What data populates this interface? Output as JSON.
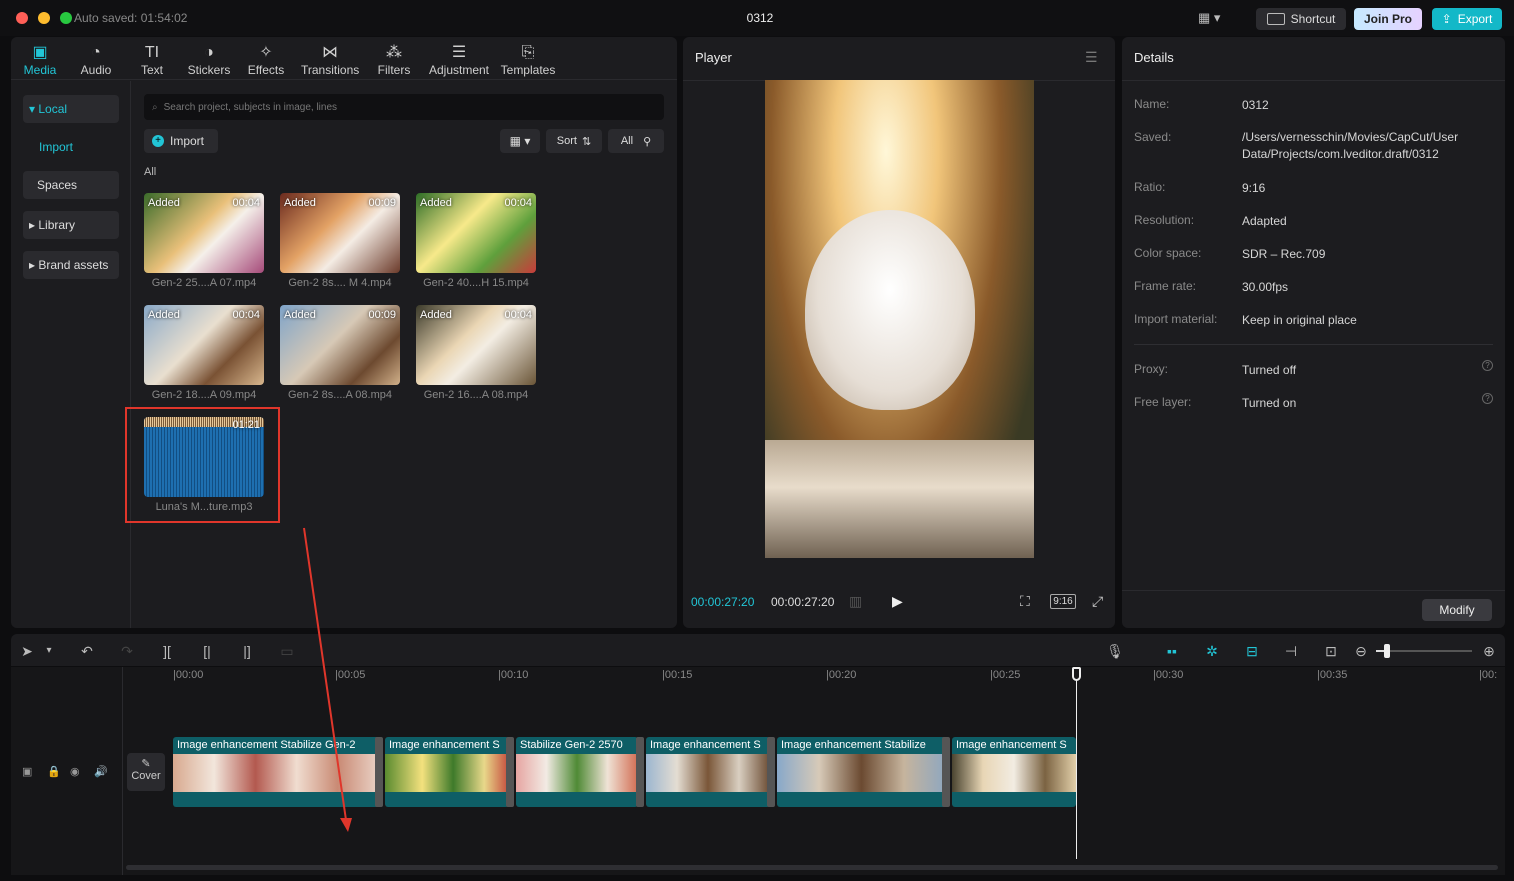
{
  "titlebar": {
    "autosave": "Auto saved: 01:54:02",
    "project_title": "0312",
    "shortcut_label": "Shortcut",
    "join_pro_label": "Join Pro",
    "export_label": "Export"
  },
  "media_tabs": [
    {
      "label": "Media",
      "icon": "media-icon"
    },
    {
      "label": "Audio",
      "icon": "audio-icon"
    },
    {
      "label": "Text",
      "icon": "text-icon"
    },
    {
      "label": "Stickers",
      "icon": "stickers-icon"
    },
    {
      "label": "Effects",
      "icon": "effects-icon"
    },
    {
      "label": "Transitions",
      "icon": "transitions-icon"
    },
    {
      "label": "Filters",
      "icon": "filters-icon"
    },
    {
      "label": "Adjustment",
      "icon": "adjustment-icon"
    },
    {
      "label": "Templates",
      "icon": "templates-icon"
    }
  ],
  "sidebar": {
    "local": "Local",
    "import": "Import",
    "spaces": "Spaces",
    "library": "Library",
    "brand_assets": "Brand assets"
  },
  "media": {
    "search_placeholder": "Search project, subjects in image, lines",
    "import_label": "Import",
    "sort_label": "Sort",
    "all_filter": "All",
    "section_label": "All",
    "items": [
      {
        "added": "Added",
        "duration": "00:04",
        "name": "Gen-2 25....A 07.mp4"
      },
      {
        "added": "Added",
        "duration": "00:09",
        "name": "Gen-2 8s.... M 4.mp4"
      },
      {
        "added": "Added",
        "duration": "00:04",
        "name": "Gen-2 40....H 15.mp4"
      },
      {
        "added": "Added",
        "duration": "00:04",
        "name": "Gen-2 18....A 09.mp4"
      },
      {
        "added": "Added",
        "duration": "00:09",
        "name": "Gen-2 8s....A 08.mp4"
      },
      {
        "added": "Added",
        "duration": "00:04",
        "name": "Gen-2 16....A 08.mp4"
      },
      {
        "added": "",
        "duration": "01:21",
        "name": "Luna's M...ture.mp3"
      }
    ]
  },
  "player": {
    "title": "Player",
    "current_time": "00:00:27:20",
    "total_time": "00:00:27:20",
    "ratio": "9:16"
  },
  "details": {
    "title": "Details",
    "rows": [
      {
        "label": "Name:",
        "value": "0312"
      },
      {
        "label": "Saved:",
        "value": "/Users/vernesschin/Movies/CapCut/User Data/Projects/com.lveditor.draft/0312"
      },
      {
        "label": "Ratio:",
        "value": "9:16"
      },
      {
        "label": "Resolution:",
        "value": "Adapted"
      },
      {
        "label": "Color space:",
        "value": "SDR – Rec.709"
      },
      {
        "label": "Frame rate:",
        "value": "30.00fps"
      },
      {
        "label": "Import material:",
        "value": "Keep in original place"
      },
      {
        "label": "Proxy:",
        "value": "Turned off"
      },
      {
        "label": "Free layer:",
        "value": "Turned on"
      }
    ],
    "modify_label": "Modify"
  },
  "timeline": {
    "ruler": [
      "00:00",
      "00:05",
      "00:10",
      "00:15",
      "00:20",
      "00:25",
      "00:30",
      "00:35",
      "00:"
    ],
    "cover_label": "Cover",
    "clips": [
      {
        "text": "Image enhancement  Stabilize  Gen-2"
      },
      {
        "text": "Image enhancement  S"
      },
      {
        "text": "Stabilize  Gen-2 2570"
      },
      {
        "text": "Image enhancement  S"
      },
      {
        "text": "Image enhancement  Stabilize"
      },
      {
        "text": "Image enhancement  S"
      }
    ]
  },
  "colors": {
    "accent": "#22c5d6",
    "highlight_box": "#e0362b",
    "clip": "#0e5e66"
  }
}
